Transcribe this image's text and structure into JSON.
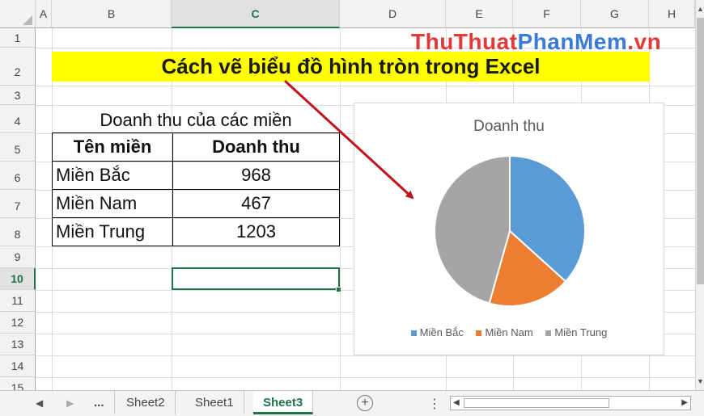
{
  "columns": [
    "A",
    "B",
    "C",
    "D",
    "E",
    "F",
    "G",
    "H"
  ],
  "rows": [
    "1",
    "2",
    "3",
    "4",
    "5",
    "6",
    "7",
    "8",
    "9",
    "10",
    "11",
    "12",
    "13",
    "14",
    "15"
  ],
  "selected_column": "C",
  "selected_row": "10",
  "sheet": {
    "title": "Cách vẽ biểu đồ hình tròn trong Excel",
    "watermark": {
      "part1": "ThuThuat",
      "part2": "PhanMem",
      "part3": ".vn"
    },
    "caption": "Doanh thu của các miền",
    "table": {
      "headers": [
        "Tên miền",
        "Doanh thu"
      ],
      "rows": [
        [
          "Miền Bắc",
          "968"
        ],
        [
          "Miền Nam",
          "467"
        ],
        [
          "Miền Trung",
          "1203"
        ]
      ]
    }
  },
  "chart_data": {
    "type": "pie",
    "title": "Doanh thu",
    "categories": [
      "Miền Bắc",
      "Miền Nam",
      "Miền Trung"
    ],
    "values": [
      968,
      467,
      1203
    ],
    "colors": [
      "#5b9bd5",
      "#ed7d31",
      "#a5a5a5"
    ],
    "legend": "bottom"
  },
  "tabs": {
    "ellipsis": "...",
    "sheets": [
      "Sheet2",
      "Sheet1",
      "Sheet3"
    ],
    "active": "Sheet3",
    "add_icon": "+"
  },
  "colors": {
    "accent": "#217346",
    "highlight": "#ffff00",
    "arrow": "#c0141c"
  }
}
